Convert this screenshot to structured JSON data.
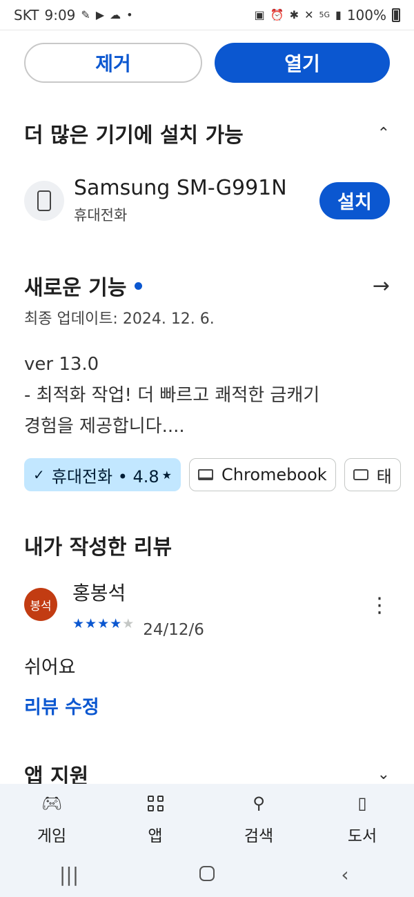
{
  "status_bar": {
    "carrier": "SKT",
    "time": "9:09",
    "network": "5G",
    "battery": "100%"
  },
  "top_buttons": {
    "remove": "제거",
    "open": "열기"
  },
  "more_devices": {
    "title": "더 많은 기기에 설치 가능",
    "device_name": "Samsung SM-G991N",
    "device_type": "휴대전화",
    "install": "설치"
  },
  "whats_new": {
    "title": "새로운 기능",
    "updated": "최종 업데이트: 2024. 12. 6.",
    "line1": "ver 13.0",
    "line2": "- 최적화 작업! 더 빠르고 쾌적한 금캐기",
    "line3": "경험을 제공합니다...."
  },
  "chips": {
    "phone_label": "휴대전화 • 4.8",
    "phone_star": "★",
    "chromebook_label": "Chromebook",
    "tablet_label": "태"
  },
  "review": {
    "title": "내가 작성한 리뷰",
    "avatar_text": "봉석",
    "author": "홍봉석",
    "rating": 4,
    "rating_max": 5,
    "date": "24/12/6",
    "text": "쉬어요",
    "edit": "리뷰 수정"
  },
  "app_support": {
    "title": "앱 지원"
  },
  "bottom_nav": {
    "games": "게임",
    "apps": "앱",
    "search": "검색",
    "books": "도서"
  },
  "colors": {
    "accent": "#0b57d0",
    "chip_selected": "#c2e7ff",
    "avatar": "#c23c12",
    "nav_bg": "#f0f4f9"
  }
}
